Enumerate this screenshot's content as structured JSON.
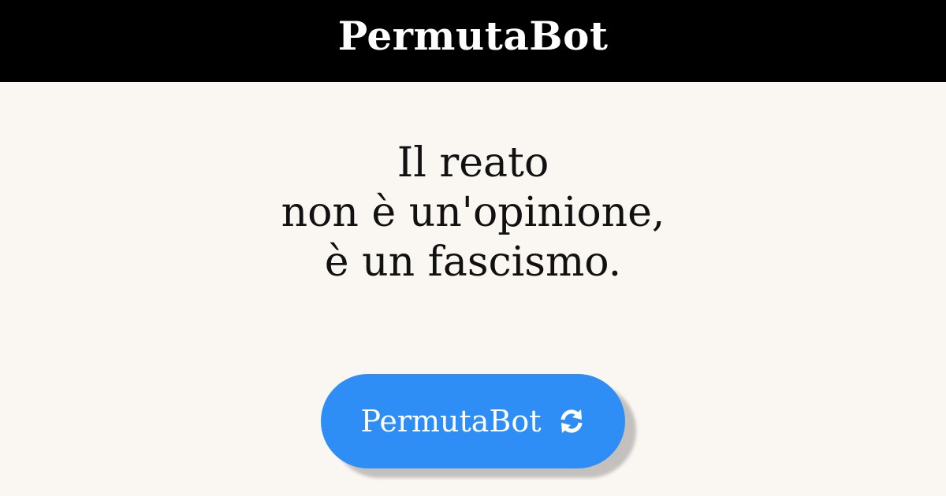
{
  "header": {
    "title": "PermutaBot"
  },
  "quote": {
    "lines": [
      "Il reato",
      "non è un'opinione,",
      "è un fascismo."
    ]
  },
  "button": {
    "label": "PermutaBot",
    "icon": "refresh-icon"
  },
  "colors": {
    "header_background": "#000000",
    "page_background": "#faf7f2",
    "button_background": "#2e8ef5",
    "text": "#111111"
  }
}
